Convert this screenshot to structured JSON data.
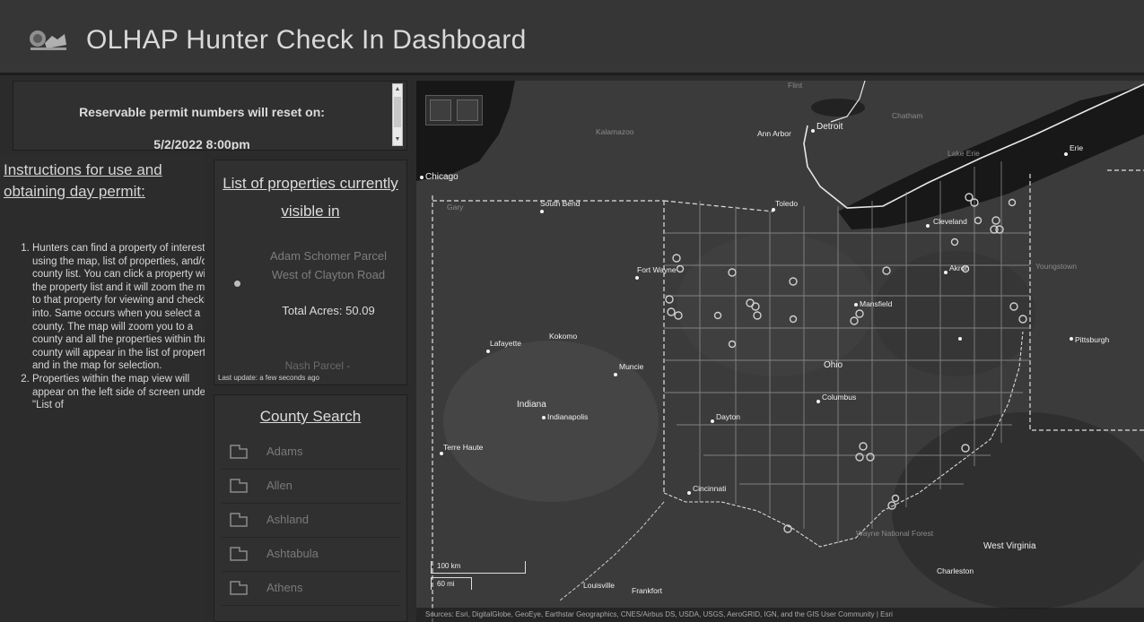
{
  "header": {
    "title": "OLHAP Hunter Check In Dashboard"
  },
  "reset_notice": {
    "line1": "Reservable permit numbers will reset on:",
    "line2": "5/2/2022 8:00pm"
  },
  "instructions": {
    "heading": "Instructions for use and obtaining day permit:",
    "items": [
      "Hunters can find a property of interest by using the map, list of properties, and/or county list. You can click a property within the property list and it will zoom the map to that property for viewing and checking into. Same occurs when you select a county. The map will zoom you to a county and all the properties within that county will appear in the list of properties and in the map for selection.",
      "Properties within the map view will appear on the left side of screen under \"List of"
    ]
  },
  "property_list": {
    "heading": "List of properties currently visible in",
    "items": [
      {
        "name": "Adam Schomer Parcel West of Clayton Road",
        "acres": "Total Acres: 50.09"
      }
    ],
    "next_item_partial": "Nash Parcel -",
    "last_update": "Last update: a few seconds ago"
  },
  "county_search": {
    "heading": "County Search",
    "counties": [
      "Adams",
      "Allen",
      "Ashland",
      "Ashtabula",
      "Athens"
    ]
  },
  "map": {
    "labels": {
      "bright": [
        "Chicago",
        "South Bend",
        "Toledo",
        "Ann Arbor",
        "Detroit",
        "Cleveland",
        "Akron",
        "Fort Wayne",
        "Mansfield",
        "Ohio",
        "Columbus",
        "Dayton",
        "Indianapolis",
        "Indiana",
        "Cincinnati",
        "Lafayette",
        "Muncie",
        "Kokomo",
        "Terre Haute",
        "Louisville",
        "Frankfort",
        "Charleston",
        "West Virginia",
        "Pittsburgh",
        "Youngstown",
        "Erie",
        "Gary",
        "Flint",
        "Chatham",
        "Lake Erie"
      ],
      "dim": [
        "Kalamazoo",
        "Wayne National Forest"
      ]
    },
    "scale": {
      "km": "100 km",
      "mi": "60 mi"
    },
    "attribution": "Sources: Esri, DigitalGlobe, GeoEye, Earthstar Geographics, CNES/Airbus DS, USDA, USGS, AeroGRID, IGN, and the GIS User Community | Esri"
  },
  "colors": {
    "background": "#2b2b2b",
    "panel": "#303030",
    "header": "#363636",
    "map_land": "#3a3a3a",
    "lake": "#1a1a1a"
  }
}
